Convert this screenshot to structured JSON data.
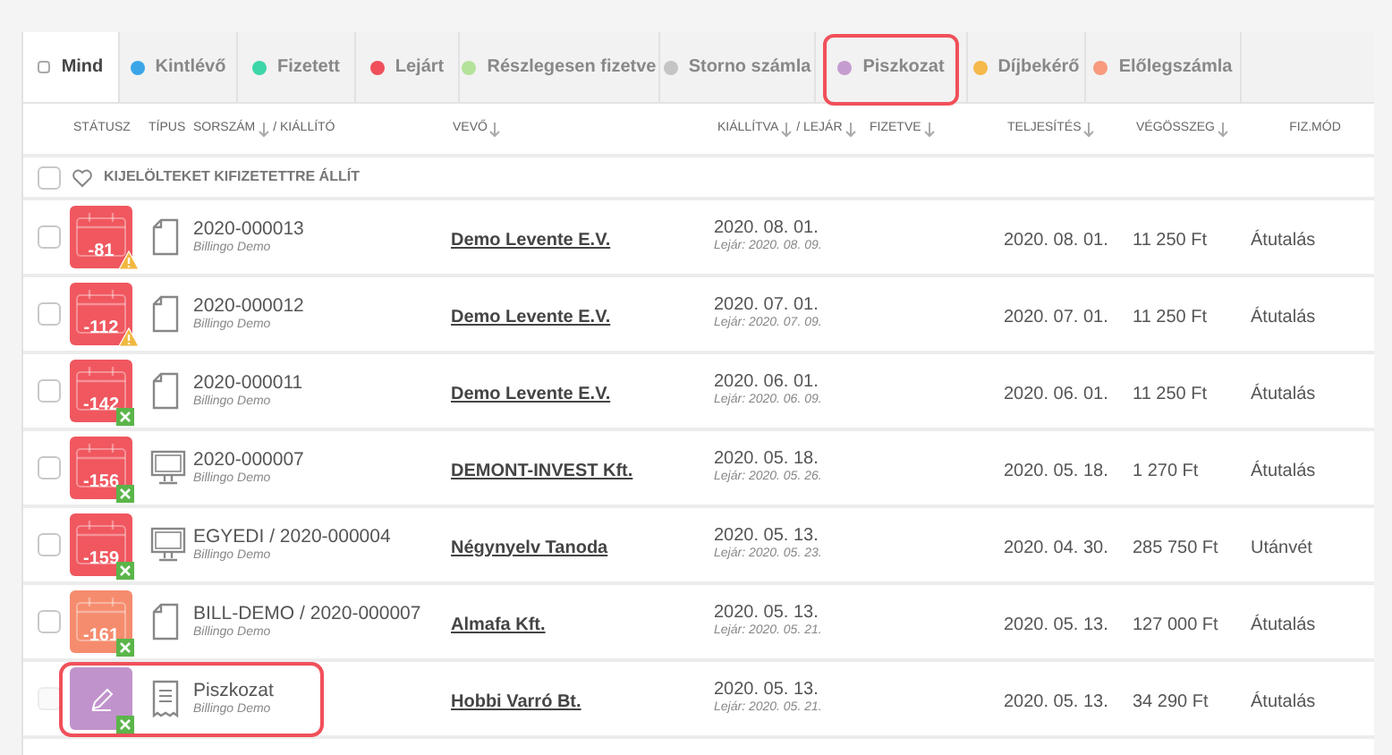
{
  "tabs": [
    {
      "label": "Mind",
      "selected": true,
      "highlighted": false
    },
    {
      "label": "Kintlévő",
      "color": "#3aa6e8",
      "selected": false,
      "highlighted": false
    },
    {
      "label": "Fizetett",
      "color": "#3dd6a8",
      "selected": false,
      "highlighted": false
    },
    {
      "label": "Lejárt",
      "color": "#f0505a",
      "selected": false,
      "highlighted": false
    },
    {
      "label": "Részlegesen fizetve",
      "color": "#b5e29a",
      "selected": false,
      "highlighted": false
    },
    {
      "label": "Storno számla",
      "color": "#c4c4c4",
      "selected": false,
      "highlighted": false
    },
    {
      "label": "Piszkozat",
      "color": "#c59ccf",
      "selected": false,
      "highlighted": true
    },
    {
      "label": "Díjbekérő",
      "color": "#f5b84a",
      "selected": false,
      "highlighted": false
    },
    {
      "label": "Előlegszámla",
      "color": "#f79a7e",
      "selected": false,
      "highlighted": false
    }
  ],
  "columns": [
    {
      "label": "STÁTUSZ",
      "sortable": false
    },
    {
      "label": "TÍPUS",
      "sortable": false
    },
    {
      "label": "SORSZÁM",
      "sortable": true,
      "suffix": "/ KIÁLLÍTÓ",
      "suffix_sortable": false
    },
    {
      "label": "VEVŐ",
      "sortable": true
    },
    {
      "label": "KIÁLLÍTVA",
      "sortable": true,
      "suffix": "/ LEJÁR",
      "suffix_sortable": true
    },
    {
      "label": "FIZETVE",
      "sortable": true
    },
    {
      "label": "TELJESÍTÉS",
      "sortable": true
    },
    {
      "label": "VÉGÖSSZEG",
      "sortable": true
    },
    {
      "label": "FIZ.MÓD",
      "sortable": false
    }
  ],
  "bulk_action": {
    "label": "KIJELÖLTEKET KIFIZETETTRE ÁLLÍT",
    "checked": false
  },
  "rows": [
    {
      "checked": false,
      "disabled": false,
      "highlighted": false,
      "status": {
        "kind": "calendar",
        "days": "-81",
        "color": "#f0575f"
      },
      "flag": {
        "kind": "warning"
      },
      "type_icon": {
        "kind": "document"
      },
      "number": "2020-000013",
      "issuer": "Billingo Demo",
      "buyer": "Demo Levente E.V.",
      "issued": "2020. 08. 01.",
      "due": "Lejár: 2020. 08. 09.",
      "fulfilled": "2020. 08. 01.",
      "total": "11 250 Ft",
      "method": "Átutalás"
    },
    {
      "checked": false,
      "disabled": false,
      "highlighted": false,
      "status": {
        "kind": "calendar",
        "days": "-112",
        "color": "#f0575f"
      },
      "flag": {
        "kind": "warning"
      },
      "type_icon": {
        "kind": "document"
      },
      "number": "2020-000012",
      "issuer": "Billingo Demo",
      "buyer": "Demo Levente E.V.",
      "issued": "2020. 07. 01.",
      "due": "Lejár: 2020. 07. 09.",
      "fulfilled": "2020. 07. 01.",
      "total": "11 250 Ft",
      "method": "Átutalás"
    },
    {
      "checked": false,
      "disabled": false,
      "highlighted": false,
      "status": {
        "kind": "calendar",
        "days": "-142",
        "color": "#f0575f"
      },
      "flag": {
        "kind": "spreadsheet"
      },
      "type_icon": {
        "kind": "document"
      },
      "number": "2020-000011",
      "issuer": "Billingo Demo",
      "buyer": "Demo Levente E.V.",
      "issued": "2020. 06. 01.",
      "due": "Lejár: 2020. 06. 09.",
      "fulfilled": "2020. 06. 01.",
      "total": "11 250 Ft",
      "method": "Átutalás"
    },
    {
      "checked": false,
      "disabled": false,
      "highlighted": false,
      "status": {
        "kind": "calendar",
        "days": "-156",
        "color": "#f0575f"
      },
      "flag": {
        "kind": "spreadsheet"
      },
      "type_icon": {
        "kind": "monitor"
      },
      "number": "2020-000007",
      "issuer": "Billingo Demo",
      "buyer": "DEMONT-INVEST Kft.",
      "issued": "2020. 05. 18.",
      "due": "Lejár: 2020. 05. 26.",
      "fulfilled": "2020. 05. 18.",
      "total": "1 270 Ft",
      "method": "Átutalás"
    },
    {
      "checked": false,
      "disabled": false,
      "highlighted": false,
      "status": {
        "kind": "calendar",
        "days": "-159",
        "color": "#f0575f"
      },
      "flag": {
        "kind": "spreadsheet"
      },
      "type_icon": {
        "kind": "monitor"
      },
      "number": "EGYEDI / 2020-000004",
      "issuer": "Billingo Demo",
      "buyer": "Négynyelv Tanoda",
      "issued": "2020. 05. 13.",
      "due": "Lejár: 2020. 05. 23.",
      "fulfilled": "2020. 04. 30.",
      "total": "285 750 Ft",
      "method": "Utánvét"
    },
    {
      "checked": false,
      "disabled": false,
      "highlighted": false,
      "status": {
        "kind": "calendar",
        "days": "-161",
        "color": "#f58c6e"
      },
      "flag": {
        "kind": "spreadsheet"
      },
      "type_icon": {
        "kind": "document"
      },
      "number": "BILL-DEMO / 2020-000007",
      "issuer": "Billingo Demo",
      "buyer": "Almafa Kft.",
      "issued": "2020. 05. 13.",
      "due": "Lejár: 2020. 05. 21.",
      "fulfilled": "2020. 05. 13.",
      "total": "127 000 Ft",
      "method": "Átutalás"
    },
    {
      "checked": false,
      "disabled": true,
      "highlighted": true,
      "status": {
        "kind": "draft",
        "color": "#c193cc"
      },
      "flag": {
        "kind": "spreadsheet"
      },
      "type_icon": {
        "kind": "receipt"
      },
      "number": "Piszkozat",
      "issuer": "Billingo Demo",
      "buyer": "Hobbi Varró Bt.",
      "issued": "2020. 05. 13.",
      "due": "Lejár: 2020. 05. 21.",
      "fulfilled": "2020. 05. 13.",
      "total": "34 290 Ft",
      "method": "Átutalás"
    }
  ]
}
